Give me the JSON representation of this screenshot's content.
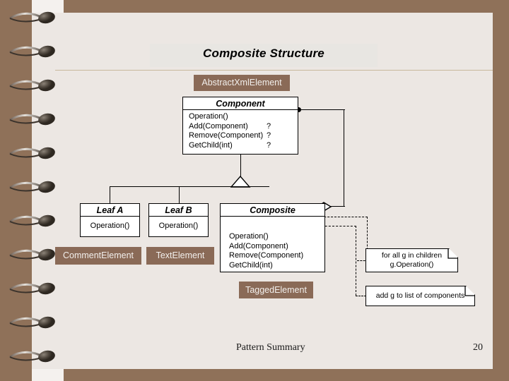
{
  "slide": {
    "title": "Composite Structure",
    "footer_label": "Pattern Summary",
    "page_number": "20",
    "colors": {
      "frame": "#8f7159",
      "page": "#ece7e3",
      "brand_box": "#8a6a57",
      "title_band": "#e8e6e2",
      "rule": "#c8b89c"
    }
  },
  "mapping_labels": {
    "abstract_xml_element": "AbstractXmlElement",
    "comment_element": "CommentElement",
    "text_element": "TextElement",
    "tagged_element": "TaggedElement"
  },
  "classes": {
    "component": {
      "name": "Component",
      "operations": [
        {
          "text": "Operation()",
          "mark": ""
        },
        {
          "text": "Add(Component)",
          "mark": "?"
        },
        {
          "text": "Remove(Component)",
          "mark": "?"
        },
        {
          "text": "GetChild(int)",
          "mark": "?"
        }
      ]
    },
    "leaf_a": {
      "name": "Leaf  A",
      "operations": [
        {
          "text": "Operation()",
          "mark": ""
        }
      ]
    },
    "leaf_b": {
      "name": "Leaf  B",
      "operations": [
        {
          "text": "Operation()",
          "mark": ""
        }
      ]
    },
    "composite": {
      "name": "Composite",
      "operations": [
        {
          "text": "Operation()",
          "mark": ""
        },
        {
          "text": "Add(Component)",
          "mark": ""
        },
        {
          "text": "Remove(Component)",
          "mark": ""
        },
        {
          "text": "GetChild(int)",
          "mark": ""
        }
      ]
    }
  },
  "notes": {
    "operation_note": {
      "line1": "for all g in children",
      "line2": "g.Operation()"
    },
    "add_note": {
      "line1": "add g to list of components"
    }
  }
}
